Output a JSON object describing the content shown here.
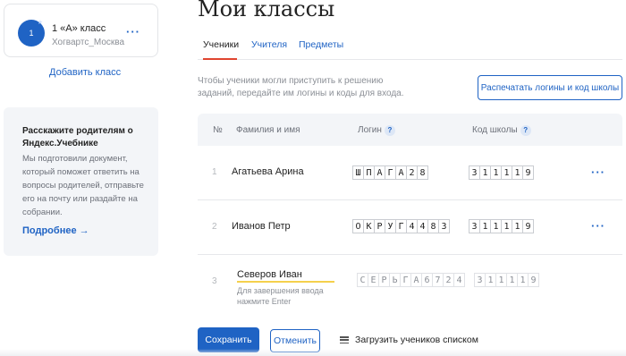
{
  "sidebar": {
    "class_card": {
      "avatar_text": "1",
      "name": "1 «А» класс",
      "school": "Хогвартс_Москва",
      "more": "···"
    },
    "add_class": "Добавить класс",
    "promo": {
      "title": "Расскажите родителям о Яндекс.Учебнике",
      "text": "Мы подготовили документ, который поможет ответить на вопросы родителей, отправьте его на почту или раздайте на собрании.",
      "link": "Подробнее →"
    }
  },
  "main": {
    "title": "Мои классы",
    "tabs": [
      {
        "label": "Ученики",
        "active": true
      },
      {
        "label": "Учителя",
        "active": false
      },
      {
        "label": "Предметы",
        "active": false
      }
    ],
    "hint": "Чтобы ученики могли приступить к решению заданий, передайте им логины и коды для входа.",
    "print_button": "Распечатать логины и код школы",
    "table": {
      "headers": {
        "num": "№",
        "name": "Фамилия и имя",
        "login": "Логин",
        "code": "Код школы",
        "help": "?"
      },
      "rows": [
        {
          "num": "1",
          "name": "Агатьева Арина",
          "login": [
            "Ш",
            "П",
            "А",
            "Г",
            "А",
            "2",
            "8"
          ],
          "code": [
            "3",
            "1",
            "1",
            "1",
            "1",
            "9"
          ]
        },
        {
          "num": "2",
          "name": "Иванов Петр",
          "login": [
            "О",
            "К",
            "Р",
            "У",
            "Г",
            "4",
            "4",
            "8",
            "3"
          ],
          "code": [
            "3",
            "1",
            "1",
            "1",
            "1",
            "9"
          ]
        },
        {
          "num": "3",
          "name": "Северов Иван",
          "login": [
            "С",
            "Е",
            "Р",
            "Ь",
            "Г",
            "А",
            "6",
            "7",
            "2",
            "4"
          ],
          "code": [
            "3",
            "1",
            "1",
            "1",
            "1",
            "9"
          ],
          "edit_hint": "Для завершения ввода нажмите Enter"
        }
      ],
      "row_more": "···"
    },
    "save_button": "Сохранить",
    "cancel_button": "Отменить",
    "upload_list": "Загрузить учеников списком"
  },
  "colors": {
    "accent": "#1f63c4",
    "tab_underline": "#e0452f",
    "edit_underline": "#f5d04c"
  }
}
